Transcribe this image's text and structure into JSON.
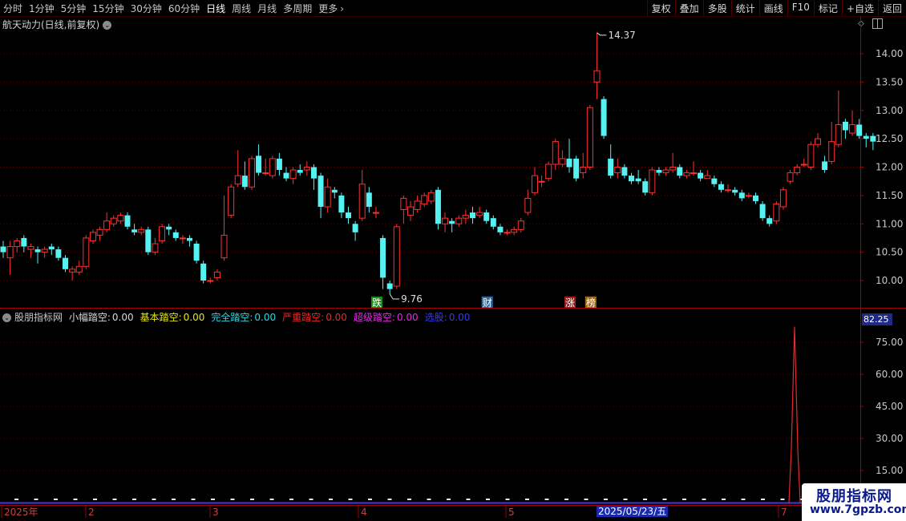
{
  "toolbar": {
    "tabs": [
      "分时",
      "1分钟",
      "5分钟",
      "15分钟",
      "30分钟",
      "60分钟",
      "日线",
      "周线",
      "月线",
      "多周期",
      "更多"
    ],
    "active_tab": "日线",
    "more_arrow": "›",
    "right_buttons": [
      "复权",
      "叠加",
      "多股",
      "统计",
      "画线",
      "F10",
      "标记",
      "+自选",
      "返回"
    ]
  },
  "chart_title": "航天动力(日线,前复权)",
  "dropdown_glyph": "⌄",
  "price_axis": [
    "14.00",
    "13.50",
    "13.00",
    "12.50",
    "12.00",
    "11.50",
    "11.00",
    "10.50",
    "10.00"
  ],
  "price_high_label": "14.37",
  "price_low_label": "9.76",
  "signals": [
    {
      "text": "跌",
      "color": "#1a8a1a"
    },
    {
      "text": "财",
      "color": "#2a6aa8"
    },
    {
      "text": "涨",
      "color": "#a01a1a"
    },
    {
      "text": "榜",
      "color": "#a06a1a"
    }
  ],
  "indicator": {
    "name": "股朋指标网",
    "items": [
      {
        "label": "小幅踏空:",
        "value": "0.00",
        "color": "#d8d8d8"
      },
      {
        "label": "基本踏空:",
        "value": "0.00",
        "color": "#e6e61a"
      },
      {
        "label": "完全踏空:",
        "value": "0.00",
        "color": "#2ad8e6"
      },
      {
        "label": "严重踏空:",
        "value": "0.00",
        "color": "#e62a2a"
      },
      {
        "label": "超级踏空:",
        "value": "0.00",
        "color": "#e62ae6"
      },
      {
        "label": "选股:",
        "value": "0.00",
        "color": "#3a3ae6"
      }
    ],
    "axis": [
      "75.00",
      "60.00",
      "45.00",
      "30.00",
      "15.00"
    ],
    "top_value": "82.25"
  },
  "date_axis": {
    "labels": [
      "2025年",
      "2",
      "3",
      "4",
      "5",
      "7"
    ],
    "current": "2025/05/23/五"
  },
  "brand": {
    "name": "股朋指标网",
    "url": "www.7gpzb.com"
  },
  "colors": {
    "up": "#ff3030",
    "down": "#54f2f2",
    "grid": "#5a0000",
    "axis": "#a00000"
  },
  "chart_data": {
    "type": "candlestick",
    "series": [
      {
        "o": 10.6,
        "c": 10.5,
        "h": 10.7,
        "l": 10.4
      },
      {
        "o": 10.4,
        "c": 10.6,
        "h": 10.7,
        "l": 10.1
      },
      {
        "o": 10.6,
        "c": 10.7,
        "h": 10.75,
        "l": 10.5
      },
      {
        "o": 10.75,
        "c": 10.6,
        "h": 10.8,
        "l": 10.5
      },
      {
        "o": 10.55,
        "c": 10.6,
        "h": 10.65,
        "l": 10.4
      },
      {
        "o": 10.55,
        "c": 10.5,
        "h": 10.6,
        "l": 10.3
      },
      {
        "o": 10.5,
        "c": 10.55,
        "h": 10.6,
        "l": 10.4
      },
      {
        "o": 10.6,
        "c": 10.55,
        "h": 10.65,
        "l": 10.45
      },
      {
        "o": 10.55,
        "c": 10.4,
        "h": 10.6,
        "l": 10.35
      },
      {
        "o": 10.4,
        "c": 10.2,
        "h": 10.45,
        "l": 10.15
      },
      {
        "o": 10.15,
        "c": 10.2,
        "h": 10.25,
        "l": 10.0
      },
      {
        "o": 10.15,
        "c": 10.25,
        "h": 10.35,
        "l": 10.1
      },
      {
        "o": 10.25,
        "c": 10.75,
        "h": 10.8,
        "l": 10.2
      },
      {
        "o": 10.7,
        "c": 10.85,
        "h": 10.9,
        "l": 10.65
      },
      {
        "o": 10.8,
        "c": 10.9,
        "h": 10.95,
        "l": 10.7
      },
      {
        "o": 10.9,
        "c": 11.05,
        "h": 11.2,
        "l": 10.85
      },
      {
        "o": 11.0,
        "c": 11.1,
        "h": 11.15,
        "l": 10.95
      },
      {
        "o": 11.05,
        "c": 11.15,
        "h": 11.2,
        "l": 11.0
      },
      {
        "o": 11.15,
        "c": 10.95,
        "h": 11.2,
        "l": 10.9
      },
      {
        "o": 10.9,
        "c": 10.85,
        "h": 11.0,
        "l": 10.8
      },
      {
        "o": 10.85,
        "c": 10.9,
        "h": 10.95,
        "l": 10.8
      },
      {
        "o": 10.9,
        "c": 10.5,
        "h": 10.95,
        "l": 10.45
      },
      {
        "o": 10.5,
        "c": 10.65,
        "h": 10.75,
        "l": 10.45
      },
      {
        "o": 10.7,
        "c": 10.95,
        "h": 11.0,
        "l": 10.65
      },
      {
        "o": 10.95,
        "c": 10.9,
        "h": 11.0,
        "l": 10.8
      },
      {
        "o": 10.85,
        "c": 10.75,
        "h": 10.9,
        "l": 10.7
      },
      {
        "o": 10.75,
        "c": 10.75,
        "h": 10.8,
        "l": 10.65
      },
      {
        "o": 10.75,
        "c": 10.7,
        "h": 10.8,
        "l": 10.6
      },
      {
        "o": 10.65,
        "c": 10.35,
        "h": 10.7,
        "l": 10.3
      },
      {
        "o": 10.3,
        "c": 10.0,
        "h": 10.35,
        "l": 9.95
      },
      {
        "o": 10.0,
        "c": 10.0,
        "h": 10.05,
        "l": 9.95
      },
      {
        "o": 10.05,
        "c": 10.15,
        "h": 10.2,
        "l": 10.0
      },
      {
        "o": 10.4,
        "c": 10.8,
        "h": 11.5,
        "l": 10.35
      },
      {
        "o": 11.15,
        "c": 11.65,
        "h": 11.7,
        "l": 11.1
      },
      {
        "o": 11.7,
        "c": 11.85,
        "h": 12.3,
        "l": 11.65
      },
      {
        "o": 11.85,
        "c": 11.65,
        "h": 12.1,
        "l": 11.6
      },
      {
        "o": 11.65,
        "c": 12.15,
        "h": 12.2,
        "l": 11.6
      },
      {
        "o": 12.2,
        "c": 11.9,
        "h": 12.4,
        "l": 11.85
      },
      {
        "o": 11.9,
        "c": 11.9,
        "h": 12.15,
        "l": 11.85
      },
      {
        "o": 11.85,
        "c": 12.15,
        "h": 12.2,
        "l": 11.8
      },
      {
        "o": 12.15,
        "c": 11.95,
        "h": 12.25,
        "l": 11.85
      },
      {
        "o": 11.9,
        "c": 11.8,
        "h": 12.0,
        "l": 11.75
      },
      {
        "o": 11.8,
        "c": 11.95,
        "h": 12.0,
        "l": 11.7
      },
      {
        "o": 11.95,
        "c": 11.9,
        "h": 12.05,
        "l": 11.85
      },
      {
        "o": 11.95,
        "c": 12.0,
        "h": 12.1,
        "l": 11.85
      },
      {
        "o": 12.0,
        "c": 11.8,
        "h": 12.05,
        "l": 11.6
      },
      {
        "o": 11.85,
        "c": 11.3,
        "h": 11.9,
        "l": 11.1
      },
      {
        "o": 11.3,
        "c": 11.65,
        "h": 11.8,
        "l": 11.2
      },
      {
        "o": 11.6,
        "c": 11.55,
        "h": 11.65,
        "l": 11.45
      },
      {
        "o": 11.5,
        "c": 11.2,
        "h": 11.55,
        "l": 11.1
      },
      {
        "o": 11.2,
        "c": 11.1,
        "h": 11.3,
        "l": 11.0
      },
      {
        "o": 11.0,
        "c": 10.85,
        "h": 11.05,
        "l": 10.7
      },
      {
        "o": 11.1,
        "c": 11.7,
        "h": 11.95,
        "l": 11.05
      },
      {
        "o": 11.55,
        "c": 11.3,
        "h": 11.65,
        "l": 11.2
      },
      {
        "o": 11.2,
        "c": 11.2,
        "h": 11.3,
        "l": 11.1
      },
      {
        "o": 10.75,
        "c": 10.05,
        "h": 10.8,
        "l": 9.85
      },
      {
        "o": 9.95,
        "c": 9.85,
        "h": 10.0,
        "l": 9.76
      },
      {
        "o": 9.9,
        "c": 10.95,
        "h": 11.0,
        "l": 9.85
      },
      {
        "o": 11.25,
        "c": 11.45,
        "h": 11.5,
        "l": 11.0
      },
      {
        "o": 11.15,
        "c": 11.3,
        "h": 11.4,
        "l": 11.05
      },
      {
        "o": 11.25,
        "c": 11.4,
        "h": 11.5,
        "l": 11.2
      },
      {
        "o": 11.35,
        "c": 11.5,
        "h": 11.55,
        "l": 11.3
      },
      {
        "o": 11.4,
        "c": 11.55,
        "h": 11.6,
        "l": 11.35
      },
      {
        "o": 11.6,
        "c": 11.0,
        "h": 11.65,
        "l": 10.9
      },
      {
        "o": 11.0,
        "c": 11.1,
        "h": 11.2,
        "l": 10.85
      },
      {
        "o": 11.05,
        "c": 11.0,
        "h": 11.1,
        "l": 10.85
      },
      {
        "o": 11.0,
        "c": 11.1,
        "h": 11.15,
        "l": 10.95
      },
      {
        "o": 11.1,
        "c": 11.15,
        "h": 11.25,
        "l": 11.0
      },
      {
        "o": 11.2,
        "c": 11.1,
        "h": 11.3,
        "l": 11.0
      },
      {
        "o": 11.15,
        "c": 11.2,
        "h": 11.3,
        "l": 11.1
      },
      {
        "o": 11.2,
        "c": 11.05,
        "h": 11.25,
        "l": 11.0
      },
      {
        "o": 11.1,
        "c": 10.95,
        "h": 11.15,
        "l": 10.9
      },
      {
        "o": 10.95,
        "c": 10.85,
        "h": 11.0,
        "l": 10.8
      },
      {
        "o": 10.85,
        "c": 10.85,
        "h": 10.9,
        "l": 10.8
      },
      {
        "o": 10.85,
        "c": 10.9,
        "h": 10.95,
        "l": 10.8
      },
      {
        "o": 10.9,
        "c": 11.05,
        "h": 11.1,
        "l": 10.85
      },
      {
        "o": 11.2,
        "c": 11.45,
        "h": 11.6,
        "l": 11.15
      },
      {
        "o": 11.55,
        "c": 11.85,
        "h": 12.0,
        "l": 11.5
      },
      {
        "o": 11.75,
        "c": 11.75,
        "h": 11.85,
        "l": 11.65
      },
      {
        "o": 11.8,
        "c": 12.05,
        "h": 12.1,
        "l": 11.75
      },
      {
        "o": 12.05,
        "c": 12.45,
        "h": 12.5,
        "l": 11.95
      },
      {
        "o": 12.05,
        "c": 12.15,
        "h": 12.3,
        "l": 12.0
      },
      {
        "o": 12.15,
        "c": 12.0,
        "h": 12.5,
        "l": 11.9
      },
      {
        "o": 12.15,
        "c": 11.8,
        "h": 12.2,
        "l": 11.75
      },
      {
        "o": 11.9,
        "c": 12.0,
        "h": 12.25,
        "l": 11.8
      },
      {
        "o": 12.0,
        "c": 13.05,
        "h": 13.1,
        "l": 11.95
      },
      {
        "o": 13.5,
        "c": 13.7,
        "h": 14.37,
        "l": 13.2
      },
      {
        "o": 13.2,
        "c": 12.55,
        "h": 13.25,
        "l": 12.5
      },
      {
        "o": 12.15,
        "c": 11.85,
        "h": 12.4,
        "l": 11.8
      },
      {
        "o": 11.9,
        "c": 12.0,
        "h": 12.15,
        "l": 11.8
      },
      {
        "o": 12.0,
        "c": 11.85,
        "h": 12.05,
        "l": 11.8
      },
      {
        "o": 11.85,
        "c": 11.75,
        "h": 11.9,
        "l": 11.7
      },
      {
        "o": 11.8,
        "c": 11.75,
        "h": 11.95,
        "l": 11.7
      },
      {
        "o": 11.75,
        "c": 11.55,
        "h": 11.8,
        "l": 11.5
      },
      {
        "o": 11.55,
        "c": 11.95,
        "h": 12.0,
        "l": 11.5
      },
      {
        "o": 11.95,
        "c": 11.9,
        "h": 12.0,
        "l": 11.85
      },
      {
        "o": 11.9,
        "c": 11.95,
        "h": 12.0,
        "l": 11.85
      },
      {
        "o": 11.95,
        "c": 12.0,
        "h": 12.25,
        "l": 11.9
      },
      {
        "o": 12.0,
        "c": 11.85,
        "h": 12.05,
        "l": 11.8
      },
      {
        "o": 11.85,
        "c": 11.9,
        "h": 11.95,
        "l": 11.8
      },
      {
        "o": 11.9,
        "c": 11.9,
        "h": 12.1,
        "l": 11.85
      },
      {
        "o": 11.9,
        "c": 11.8,
        "h": 11.95,
        "l": 11.75
      },
      {
        "o": 11.8,
        "c": 11.85,
        "h": 11.95,
        "l": 11.8
      },
      {
        "o": 11.8,
        "c": 11.7,
        "h": 11.85,
        "l": 11.65
      },
      {
        "o": 11.7,
        "c": 11.6,
        "h": 11.75,
        "l": 11.55
      },
      {
        "o": 11.6,
        "c": 11.6,
        "h": 11.7,
        "l": 11.55
      },
      {
        "o": 11.6,
        "c": 11.55,
        "h": 11.65,
        "l": 11.5
      },
      {
        "o": 11.55,
        "c": 11.45,
        "h": 11.6,
        "l": 11.4
      },
      {
        "o": 11.5,
        "c": 11.5,
        "h": 11.55,
        "l": 11.45
      },
      {
        "o": 11.5,
        "c": 11.4,
        "h": 11.55,
        "l": 11.35
      },
      {
        "o": 11.35,
        "c": 11.1,
        "h": 11.4,
        "l": 11.05
      },
      {
        "o": 11.1,
        "c": 11.0,
        "h": 11.15,
        "l": 10.95
      },
      {
        "o": 11.05,
        "c": 11.35,
        "h": 11.4,
        "l": 11.0
      },
      {
        "o": 11.3,
        "c": 11.6,
        "h": 11.65,
        "l": 11.25
      },
      {
        "o": 11.75,
        "c": 11.9,
        "h": 11.95,
        "l": 11.7
      },
      {
        "o": 11.9,
        "c": 12.0,
        "h": 12.05,
        "l": 11.85
      },
      {
        "o": 12.05,
        "c": 12.05,
        "h": 12.15,
        "l": 12.0
      },
      {
        "o": 12.0,
        "c": 12.4,
        "h": 12.45,
        "l": 11.95
      },
      {
        "o": 12.4,
        "c": 12.5,
        "h": 12.6,
        "l": 12.35
      },
      {
        "o": 12.1,
        "c": 11.95,
        "h": 12.2,
        "l": 11.9
      },
      {
        "o": 12.1,
        "c": 12.45,
        "h": 12.8,
        "l": 12.05
      },
      {
        "o": 12.4,
        "c": 12.75,
        "h": 13.35,
        "l": 12.35
      },
      {
        "o": 12.8,
        "c": 12.65,
        "h": 12.85,
        "l": 12.5
      },
      {
        "o": 12.6,
        "c": 12.75,
        "h": 13.0,
        "l": 12.55
      },
      {
        "o": 12.75,
        "c": 12.55,
        "h": 12.85,
        "l": 12.5
      },
      {
        "o": 12.55,
        "c": 12.5,
        "h": 12.6,
        "l": 12.35
      },
      {
        "o": 12.55,
        "c": 12.45,
        "h": 12.6,
        "l": 12.3
      }
    ]
  }
}
